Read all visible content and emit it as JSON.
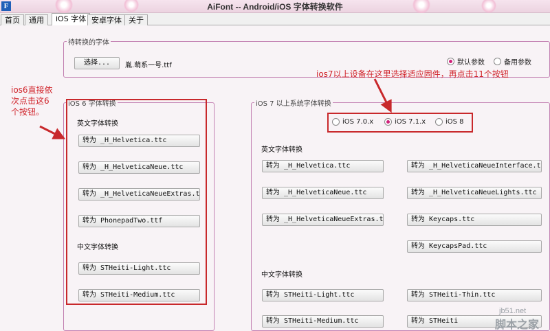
{
  "window": {
    "title": "AiFont -- Android/iOS 字体转换软件",
    "app_icon_letter": "F"
  },
  "tabs": [
    "首页",
    "通用",
    "iOS 字体",
    "安卓字体",
    "关于"
  ],
  "source_font": {
    "legend": "待转换的字体",
    "choose_label": "选择...",
    "filename": "胤.萌系一号.ttf",
    "options": [
      {
        "label": "默认参数",
        "checked": true
      },
      {
        "label": "备用参数",
        "checked": false
      }
    ]
  },
  "ios6": {
    "legend": "iOS 6 字体转换",
    "english_heading": "英文字体转换",
    "english_buttons": [
      "转为 _H_Helvetica.ttc",
      "转为 _H_HelveticaNeue.ttc",
      "转为 _H_HelveticaNeueExtras.ttc",
      "转为 PhonepadTwo.ttf"
    ],
    "chinese_heading": "中文字体转换",
    "chinese_buttons": [
      "转为 STHeiti-Light.ttc",
      "转为 STHeiti-Medium.ttc"
    ]
  },
  "ios7": {
    "legend": "iOS 7 以上系统字体转换",
    "firmware": [
      {
        "label": "iOS 7.0.x",
        "checked": false
      },
      {
        "label": "iOS 7.1.x",
        "checked": true
      },
      {
        "label": "iOS 8",
        "checked": false
      }
    ],
    "english_heading": "英文字体转换",
    "english_left": [
      "转为 _H_Helvetica.ttc",
      "转为 _H_HelveticaNeue.ttc",
      "转为 _H_HelveticaNeueExtras.ttc"
    ],
    "english_right": [
      "转为 _H_HelveticaNeueInterface.ttc",
      "转为 _H_HelveticaNeueLights.ttc",
      "转为 Keycaps.ttc",
      "转为 KeycapsPad.ttc"
    ],
    "chinese_heading": "中文字体转换",
    "chinese_left": [
      "转为 STHeiti-Light.ttc",
      "转为 STHeiti-Medium.ttc"
    ],
    "chinese_right": [
      "转为 STHeiti-Thin.ttc",
      "转为 STHeiti"
    ]
  },
  "annotations": {
    "ios6": [
      "ios6直接依",
      "次点击这6",
      "个按钮。"
    ],
    "ios7": "ios7以上设备在这里选择适应固件，再点击11个按钮"
  },
  "watermark": {
    "site": "jb51.net",
    "name": "脚本之家"
  },
  "colors": {
    "annotation": "#c8282b",
    "group_border": "#c27fb1",
    "radio_checked": "#d0217a"
  }
}
